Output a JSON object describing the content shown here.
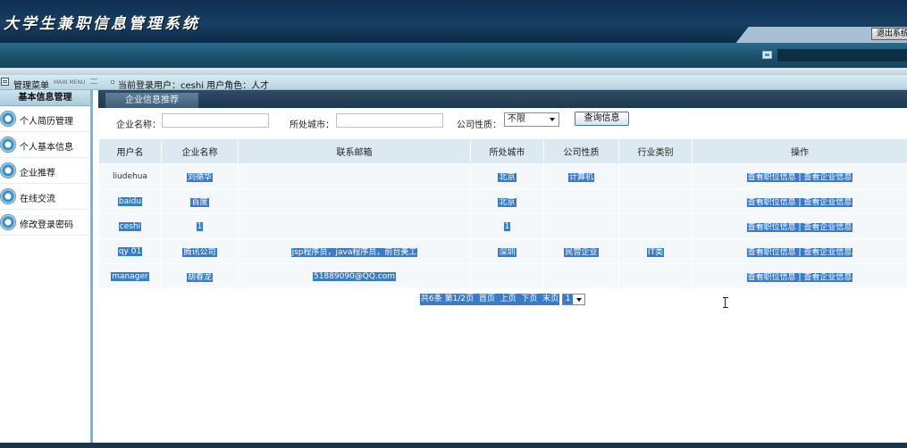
{
  "header": {
    "title": "大学生兼职信息管理系统",
    "logout_label": "退出系统"
  },
  "statusbar": {
    "menu_label": "管理菜单",
    "menu_label_en": "MAIN MENU",
    "user_info": "当前登录用户：ceshi 用户角色：人才"
  },
  "sidebar": {
    "heading": "基本信息管理",
    "items": [
      {
        "label": "个人简历管理"
      },
      {
        "label": "个人基本信息"
      },
      {
        "label": "企业推荐"
      },
      {
        "label": "在线交流"
      },
      {
        "label": "修改登录密码"
      }
    ]
  },
  "main": {
    "panel_title": "企业信息推荐",
    "search": {
      "company_name_label": "企业名称：",
      "company_name_value": "",
      "city_label": "所处城市：",
      "city_value": "",
      "nature_label": "公司性质：",
      "nature_selected": "不限",
      "query_button": "查询信息"
    },
    "table": {
      "columns": [
        "用户名",
        "企业名称",
        "联系邮箱",
        "所处城市",
        "公司性质",
        "行业类别",
        "操作"
      ],
      "rows": [
        {
          "username": "liudehua",
          "company": "刘德华",
          "email": "",
          "city": "北京",
          "nature": "计算机",
          "industry": ""
        },
        {
          "username": "baidu",
          "company": "百度",
          "email": "",
          "city": "北京",
          "nature": "",
          "industry": ""
        },
        {
          "username": "ceshi",
          "company": "1",
          "email": "",
          "city": "1",
          "nature": "",
          "industry": ""
        },
        {
          "username": "qy 01",
          "company": "腾讯公司",
          "email": "jsp程序员，java程序员，前台美工",
          "city": "深圳",
          "nature": "民营企业",
          "industry": "IT类"
        },
        {
          "username": "manager",
          "company": "胡春龙",
          "email": "51889090@QQ.com",
          "city": "",
          "nature": "",
          "industry": ""
        }
      ],
      "op_view_jobs": "查看职位信息",
      "op_sep": "|",
      "op_view_company": "查看企业信息"
    },
    "pager": {
      "summary": "共6条 第1/2页",
      "first": "首页",
      "prev": "上页",
      "next": "下页",
      "last": "末页",
      "page_value": "1"
    }
  },
  "colors": {
    "header_bg": "#183f63",
    "highlight": "#3b7bc8",
    "table_header_bg": "#dce9f0",
    "panel_title_bg": "#2f4c66"
  }
}
